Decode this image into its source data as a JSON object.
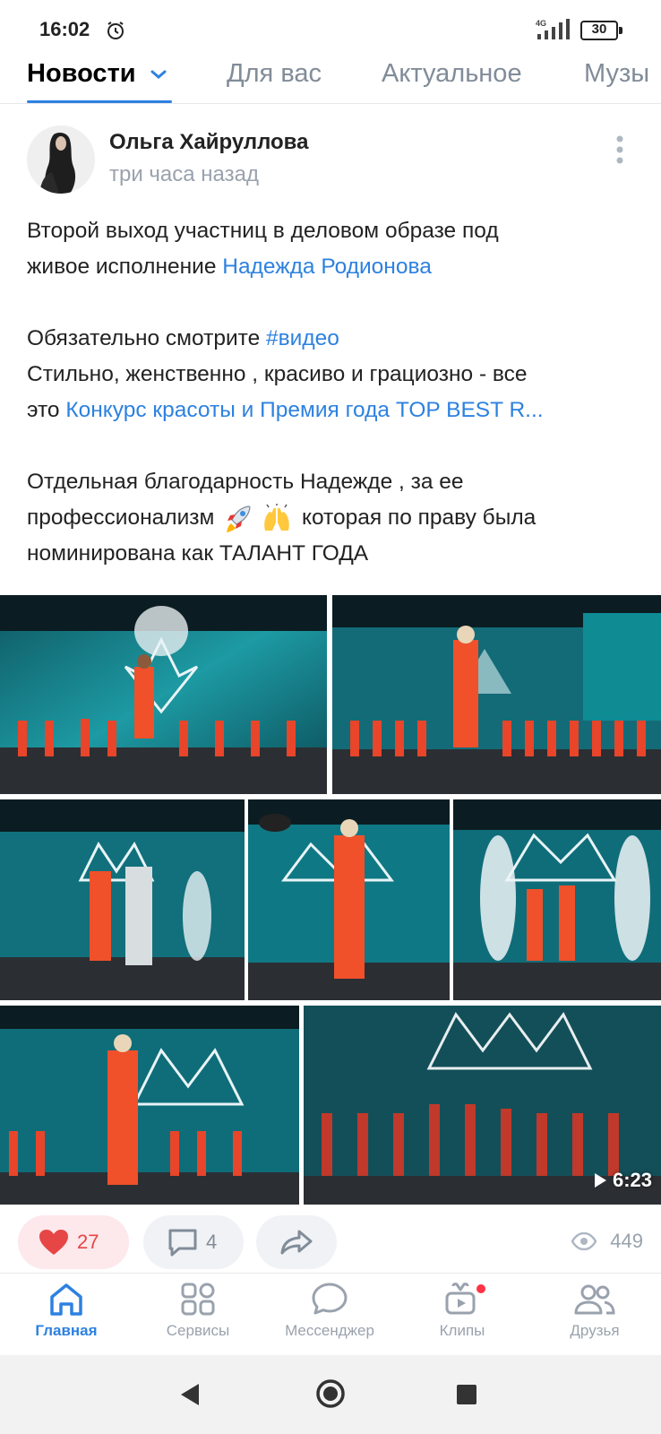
{
  "status_bar": {
    "time": "16:02",
    "network": "4G",
    "battery": "30"
  },
  "tabs": {
    "news": "Новости",
    "for_you": "Для вас",
    "actual": "Актуальное",
    "music": "Музы"
  },
  "post": {
    "author": "Ольга Хайруллова",
    "time": "три часа назад",
    "text": {
      "p1_line1": "Второй выход участниц в деловом образе под",
      "p1_line2_text": "живое исполнение ",
      "p1_line2_link": "Надежда Родионова",
      "p2_line1_text": "Обязательно смотрите ",
      "p2_line1_tag": "#видео",
      "p2_line2": "Стильно, женственно , красиво и грациозно - все",
      "p2_line3_text": "это ",
      "p2_line3_link": "Конкурс красоты и Премия года TOP BEST R...",
      "p3_line1": "Отдельная благодарность Надежде , за ее",
      "p3_line2_text": "профессионализм",
      "p3_line2_after": " которая по праву была",
      "p3_line3": "номинирована как ТАЛАНТ ГОДА"
    },
    "video_duration": "6:23",
    "likes": "27",
    "comments": "4",
    "views": "449"
  },
  "bottom_nav": {
    "main": "Главная",
    "services": "Сервисы",
    "messenger": "Мессенджер",
    "clips": "Клипы",
    "friends": "Друзья"
  },
  "colors": {
    "accent": "#2d81e0",
    "like": "#e64646",
    "stage": "#0c6f7a",
    "suit": "#f0502a"
  }
}
